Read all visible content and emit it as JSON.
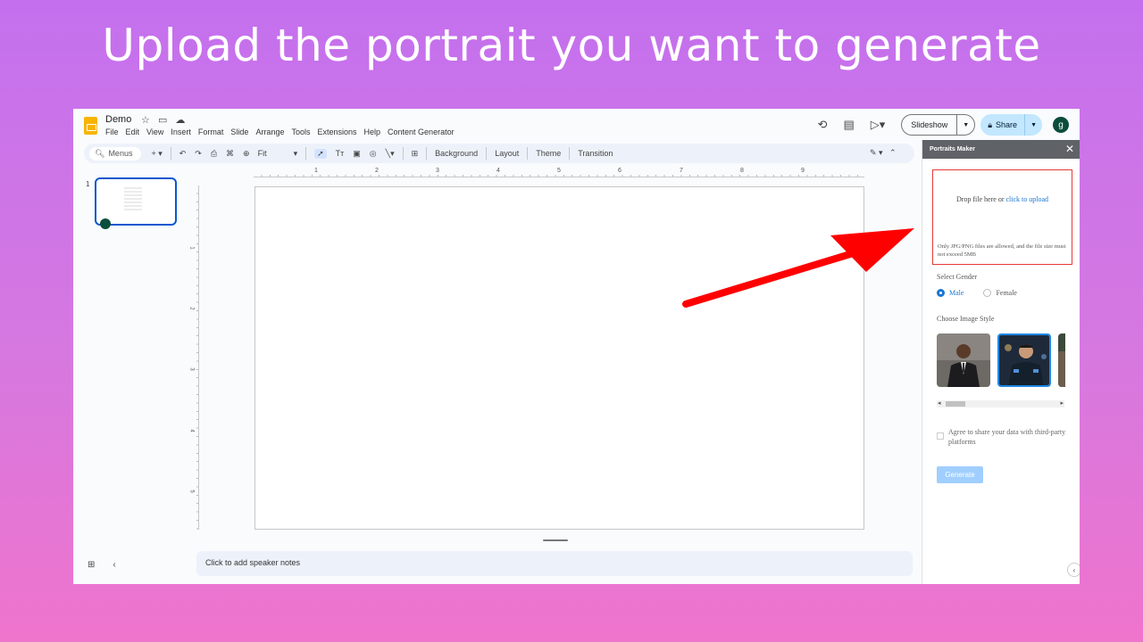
{
  "banner": {
    "text": "Upload the portrait you want to generate"
  },
  "header": {
    "doc_title": "Demo",
    "menu": [
      "File",
      "Edit",
      "View",
      "Insert",
      "Format",
      "Slide",
      "Arrange",
      "Tools",
      "Extensions",
      "Help",
      "Content Generator"
    ],
    "slideshow_label": "Slideshow",
    "share_label": "Share",
    "avatar_letter": "g"
  },
  "toolbar": {
    "menus_label": "Menus",
    "zoom_label": "Fit",
    "background_label": "Background",
    "layout_label": "Layout",
    "theme_label": "Theme",
    "transition_label": "Transition"
  },
  "filmstrip": {
    "slide_number": "1"
  },
  "ruler": {
    "h_ticks": [
      "1",
      "2",
      "3",
      "4",
      "5",
      "6",
      "7",
      "8",
      "9"
    ],
    "v_ticks": [
      "1",
      "2",
      "3",
      "4",
      "5"
    ]
  },
  "notes": {
    "placeholder": "Click to add speaker notes"
  },
  "panel": {
    "title": "Portraits Maker",
    "upload_text": "Drop file here or",
    "upload_link": "click to upload",
    "upload_hint": "Only JPG/PNG files are allowed, and the file size must not exceed 5MB",
    "gender_label": "Select Gender",
    "gender_options": [
      "Male",
      "Female"
    ],
    "gender_selected": "Male",
    "style_label": "Choose Image Style",
    "agree_text": "Agree to share your data with third-party platforms",
    "generate_label": "Generate"
  },
  "colors": {
    "accent": "#1976d2",
    "highlight_border": "#e53935",
    "arrow": "#ff0000"
  }
}
